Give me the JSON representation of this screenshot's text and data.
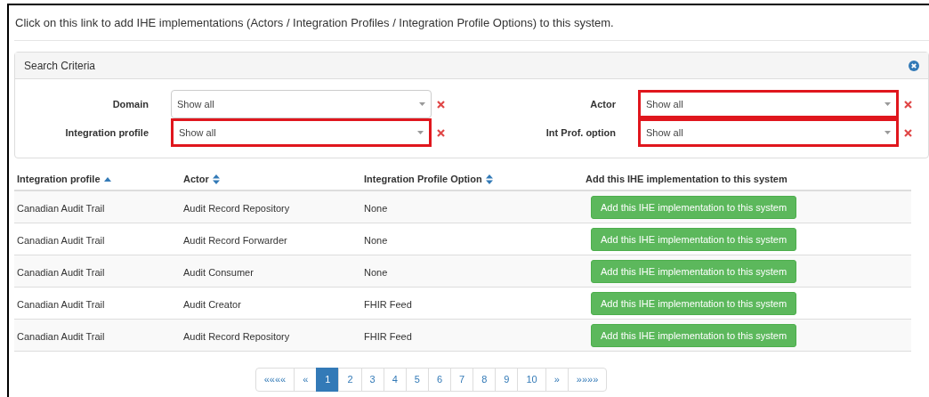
{
  "intro_link": "Click on this link to add IHE implementations (Actors / Integration Profiles / Integration Profile Options) to this system.",
  "search_panel": {
    "title": "Search Criteria",
    "filters": [
      {
        "label": "Domain",
        "value": "Show all",
        "highlighted": false
      },
      {
        "label": "Actor",
        "value": "Show all",
        "highlighted": true
      },
      {
        "label": "Integration profile",
        "value": "Show all",
        "highlighted": true
      },
      {
        "label": "Int Prof. option",
        "value": "Show all",
        "highlighted": true
      }
    ]
  },
  "table": {
    "columns": [
      {
        "label": "Integration profile",
        "sortable": true,
        "sorted_ascending": true
      },
      {
        "label": "Actor",
        "sortable": true,
        "sorted_ascending": false
      },
      {
        "label": "Integration Profile Option",
        "sortable": true,
        "sorted_ascending": false
      },
      {
        "label": "Add this IHE implementation to this system",
        "sortable": false
      }
    ],
    "rows": [
      {
        "cells": [
          "Canadian Audit Trail",
          "Audit Record Repository",
          "None"
        ],
        "button": "Add this IHE implementation to this system"
      },
      {
        "cells": [
          "Canadian Audit Trail",
          "Audit Record Forwarder",
          "None"
        ],
        "button": "Add this IHE implementation to this system"
      },
      {
        "cells": [
          "Canadian Audit Trail",
          "Audit Consumer",
          "None"
        ],
        "button": "Add this IHE implementation to this system"
      },
      {
        "cells": [
          "Canadian Audit Trail",
          "Audit Creator",
          "FHIR Feed"
        ],
        "button": "Add this IHE implementation to this system"
      },
      {
        "cells": [
          "Canadian Audit Trail",
          "Audit Record Repository",
          "FHIR Feed"
        ],
        "button": "Add this IHE implementation to this system"
      }
    ]
  },
  "pagination": [
    {
      "label": "««««",
      "selected": false
    },
    {
      "label": "«",
      "selected": false
    },
    {
      "label": "1",
      "selected": true
    },
    {
      "label": "2",
      "selected": false
    },
    {
      "label": "3",
      "selected": false
    },
    {
      "label": "4",
      "selected": false
    },
    {
      "label": "5",
      "selected": false
    },
    {
      "label": "6",
      "selected": false
    },
    {
      "label": "7",
      "selected": false
    },
    {
      "label": "8",
      "selected": false
    },
    {
      "label": "9",
      "selected": false
    },
    {
      "label": "10",
      "selected": false
    },
    {
      "label": "»",
      "selected": false
    },
    {
      "label": "»»»»",
      "selected": false
    }
  ]
}
